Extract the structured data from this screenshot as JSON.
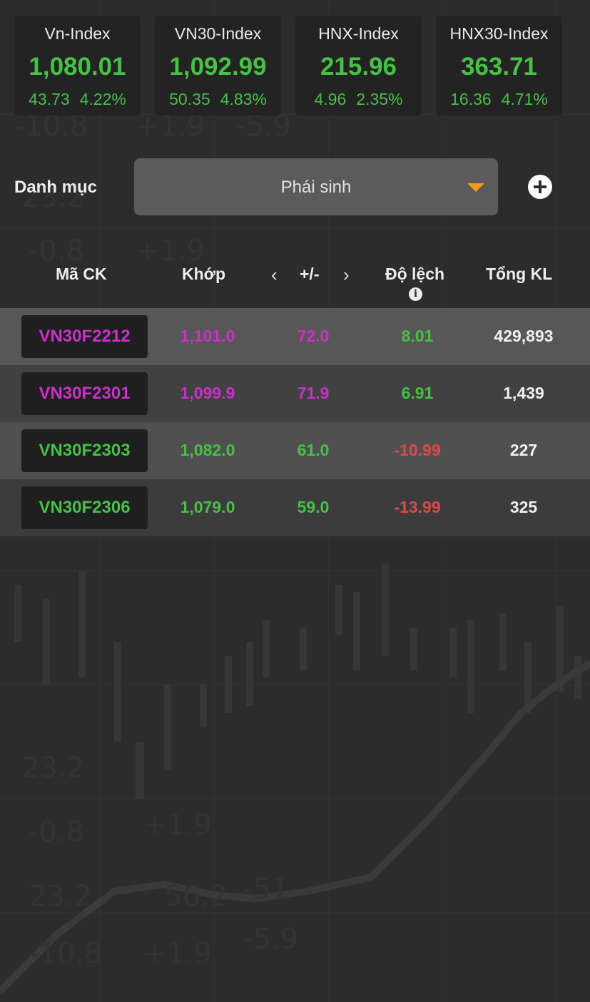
{
  "indices": [
    {
      "name": "Vn-Index",
      "value": "1,080.01",
      "change": "43.73",
      "percent": "4.22%"
    },
    {
      "name": "VN30-Index",
      "value": "1,092.99",
      "change": "50.35",
      "percent": "4.83%"
    },
    {
      "name": "HNX-Index",
      "value": "215.96",
      "change": "4.96",
      "percent": "2.35%"
    },
    {
      "name": "HNX30-Index",
      "value": "363.71",
      "change": "16.36",
      "percent": "4.71%"
    }
  ],
  "category": {
    "label": "Danh mục",
    "selected": "Phái sinh"
  },
  "table": {
    "headers": {
      "code": "Mã CK",
      "match": "Khớp",
      "change": "+/-",
      "deviation": "Độ lệch",
      "volume": "Tổng KL"
    },
    "rows": [
      {
        "code": "VN30F2212",
        "match": "1,101.0",
        "change": "72.0",
        "deviation": "8.01",
        "volume": "429,893"
      },
      {
        "code": "VN30F2301",
        "match": "1,099.9",
        "change": "71.9",
        "deviation": "6.91",
        "volume": "1,439"
      },
      {
        "code": "VN30F2303",
        "match": "1,082.0",
        "change": "61.0",
        "deviation": "-10.99",
        "volume": "227"
      },
      {
        "code": "VN30F2306",
        "match": "1,079.0",
        "change": "59.0",
        "deviation": "-13.99",
        "volume": "325"
      }
    ]
  },
  "colors": {
    "up": "#46c046",
    "ceiling": "#c932c9",
    "down": "#e04848",
    "dropdown_caret": "#f39c19"
  },
  "icons": {
    "prev": "chevron-left-icon",
    "next": "chevron-right-icon",
    "info": "info-icon",
    "add": "plus-circle-icon",
    "dropdown": "caret-down-icon"
  }
}
